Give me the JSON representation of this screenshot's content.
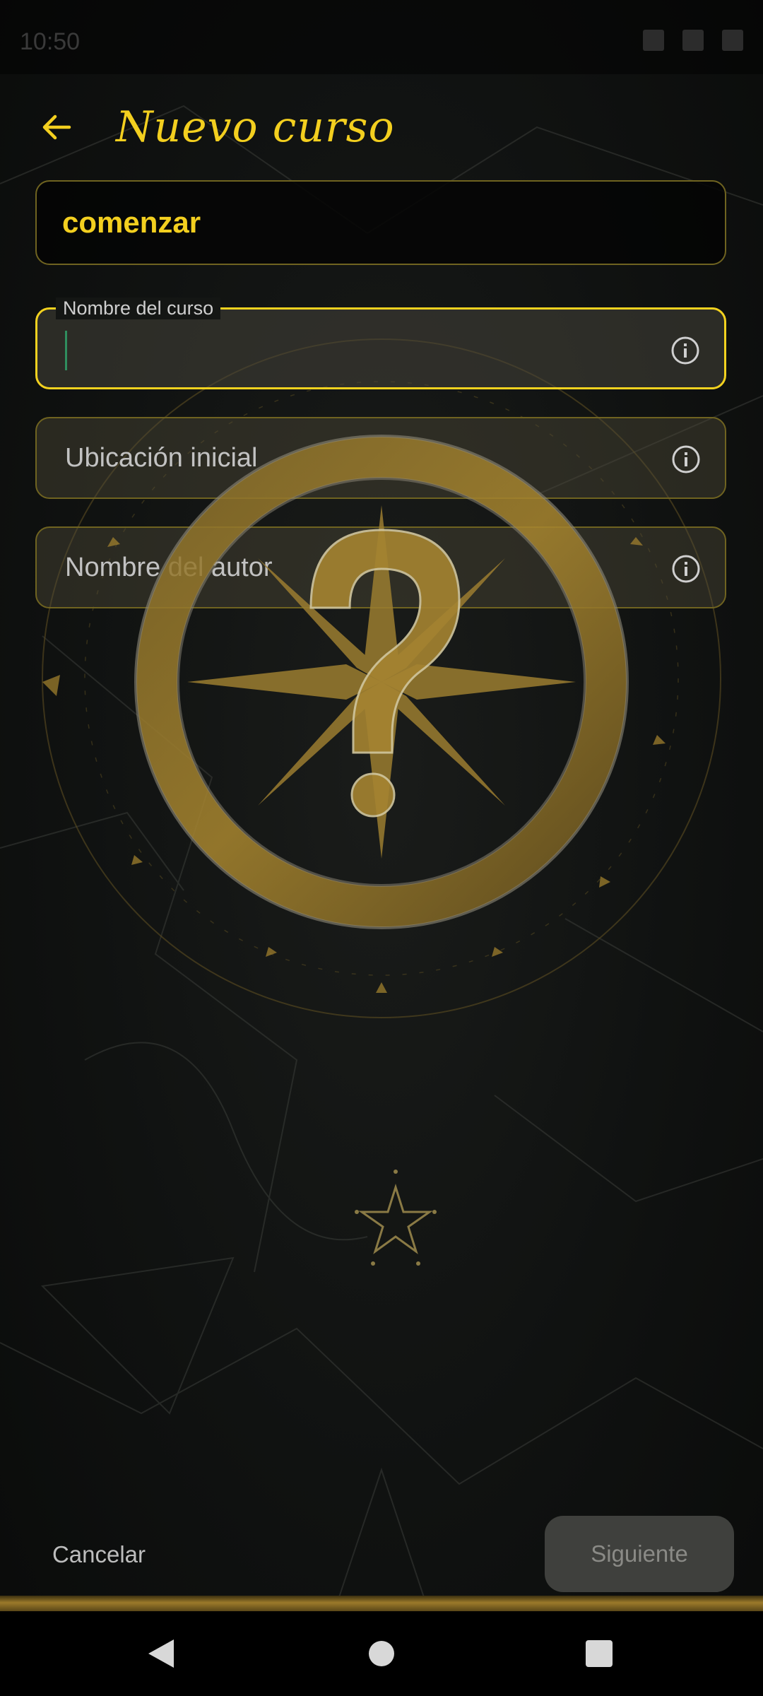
{
  "status_bar": {
    "time": "10:50"
  },
  "header": {
    "title": "Nuevo curso",
    "back_icon": "arrow-left-icon"
  },
  "start_banner": {
    "text": "comenzar"
  },
  "fields": {
    "course_name": {
      "label": "Nombre del curso",
      "value": ""
    },
    "start_location": {
      "placeholder": "Ubicación inicial"
    },
    "author_name": {
      "placeholder": "Nombre del autor"
    }
  },
  "actions": {
    "cancel_label": "Cancelar",
    "next_label": "Siguiente"
  },
  "colors": {
    "accent": "#f3cf1f",
    "gold": "#a8862f",
    "background": "#0d0f0e",
    "disabled_button": "#3f403d"
  },
  "icons": [
    "arrow-left-icon",
    "info-icon",
    "compass-question-emblem",
    "star-icon",
    "nav-back-icon",
    "nav-home-icon",
    "nav-recents-icon"
  ]
}
